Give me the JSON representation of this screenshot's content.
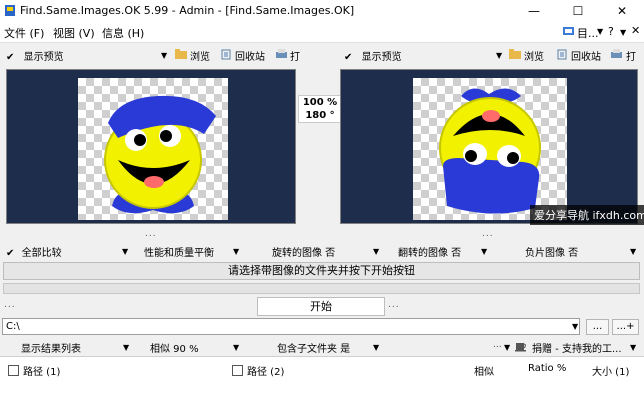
{
  "window": {
    "title": "Find.Same.Images.OK 5.99 - Admin - [Find.Same.Images.OK]",
    "minimize": "—",
    "maximize": "☐",
    "close": "✕"
  },
  "menu": [
    "文件 (F)",
    "视图 (V)",
    "信息 (H)"
  ],
  "menu_right": {
    "tools_label": "目...",
    "help": "?"
  },
  "left_panel": {
    "show_preview": "显示预览",
    "browse": "浏览",
    "recycle_bin": "回收站",
    "print": "打"
  },
  "right_panel": {
    "show_preview": "显示预览",
    "browse": "浏览",
    "recycle_bin": "回收站",
    "print": "打"
  },
  "compare": {
    "similarity": "100 %",
    "rotation": "180 °"
  },
  "watermark": "爱分享导航 ifxdh.com",
  "options": {
    "compare_all": "全部比较",
    "perf_quality": "性能和质量平衡",
    "rotated": "旋转的图像 否",
    "flipped": "翻转的图像 否",
    "negative": "负片图像 否"
  },
  "status_message": "请选择带图像的文件夹并按下开始按钮",
  "start_button": "开始",
  "dots": "...",
  "path": {
    "value": "C:\\",
    "browse_btn": "...",
    "add_btn": "...+"
  },
  "results_options": {
    "show_list": "显示结果列表",
    "similar": "相似 90 %",
    "subfolders": "包含子文件夹 是",
    "donate": "捐赠 - 支持我的工..."
  },
  "columns": {
    "path1": "路径 (1)",
    "path2": "路径 (2)",
    "similar": "相似",
    "ratio": "Ratio %",
    "size": "大小 (1)"
  },
  "colors": {
    "preview_bg": "#1f2d4d",
    "hat_blue": "#2a3ad6",
    "face_yellow": "#f2f200"
  }
}
